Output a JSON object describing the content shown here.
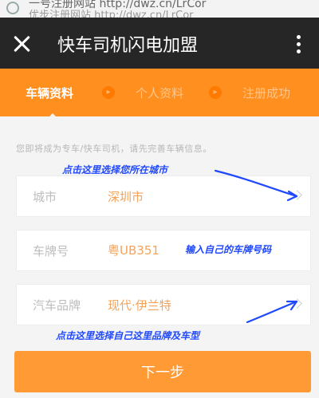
{
  "browser": {
    "url_line1": "一号注册网站 http://dwz.cn/LrCor",
    "url_line2": "优步注册网站 http://dwz.cn/LrCor"
  },
  "appbar": {
    "title": "快车司机闪电加盟",
    "close_icon": "close-icon",
    "more_icon": "more-vert-icon"
  },
  "steps": [
    {
      "label": "车辆资料",
      "active": true
    },
    {
      "label": "个人资料",
      "active": false
    },
    {
      "label": "注册成功",
      "active": false
    }
  ],
  "hint": "您即将成为专车/快车司机，请先完善车辆信息。",
  "form": {
    "city": {
      "label": "城市",
      "value": "深圳市"
    },
    "plate": {
      "label": "车牌号",
      "value": "粤UB351"
    },
    "brand": {
      "label": "汽车品牌",
      "value": "现代·伊兰特"
    }
  },
  "annotations": {
    "city_note": "点击这里选择您所在城市",
    "plate_note": "输入自己的车牌号码",
    "brand_note": "点击这里选择自己这里品牌及车型"
  },
  "colors": {
    "accent": "#ff8f1f",
    "appbar": "#262626",
    "annotation": "#1f48ff"
  },
  "next_button": "下一步"
}
